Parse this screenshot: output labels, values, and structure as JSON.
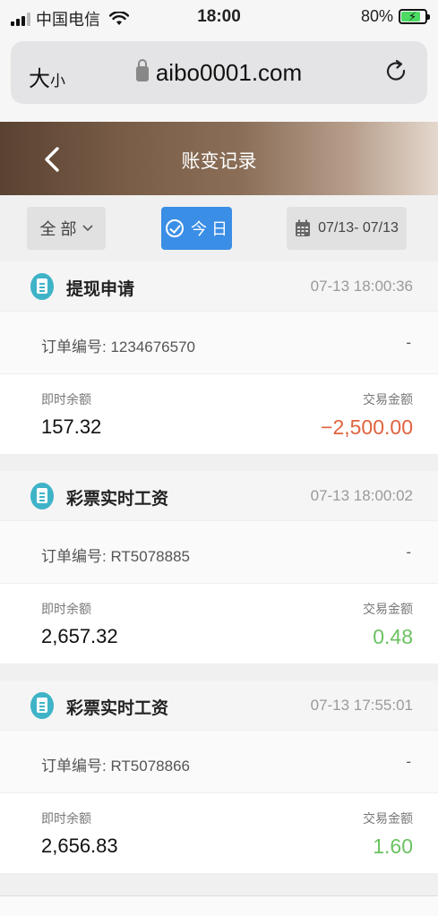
{
  "status_bar": {
    "carrier": "中国电信",
    "time": "18:00",
    "battery": "80%",
    "battery_level": 0.8
  },
  "browser": {
    "text_size_big": "大",
    "text_size_small": "小",
    "url": "aibo0001.com",
    "icons": [
      "lock-icon",
      "reload-icon"
    ]
  },
  "header": {
    "title": "账变记录"
  },
  "filters": {
    "all_label": "全 部",
    "today_label": "今 日",
    "date_range": "07/13- 07/13"
  },
  "labels": {
    "order_prefix": "订单编号: ",
    "balance": "即时余额",
    "amount": "交易金额"
  },
  "records": [
    {
      "type": "提现申请",
      "time": "07-13 18:00:36",
      "order_no": "1234676570",
      "order_extra": "-",
      "balance": "157.32",
      "amount": "−2,500.00",
      "amount_sign": "negative",
      "amount_color": "#e0633e"
    },
    {
      "type": "彩票实时工资",
      "time": "07-13 18:00:02",
      "order_no": "RT5078885",
      "order_extra": "-",
      "balance": "2,657.32",
      "amount": "0.48",
      "amount_sign": "positive",
      "amount_color": "#6bc261"
    },
    {
      "type": "彩票实时工资",
      "time": "07-13 17:55:01",
      "order_no": "RT5078866",
      "order_extra": "-",
      "balance": "2,656.83",
      "amount": "1.60",
      "amount_sign": "positive",
      "amount_color": "#6bc261"
    }
  ],
  "colors": {
    "accent_blue": "#3a8ee6",
    "negative": "#e0633e",
    "positive": "#6bc261",
    "header_dark": "#5a4232"
  }
}
